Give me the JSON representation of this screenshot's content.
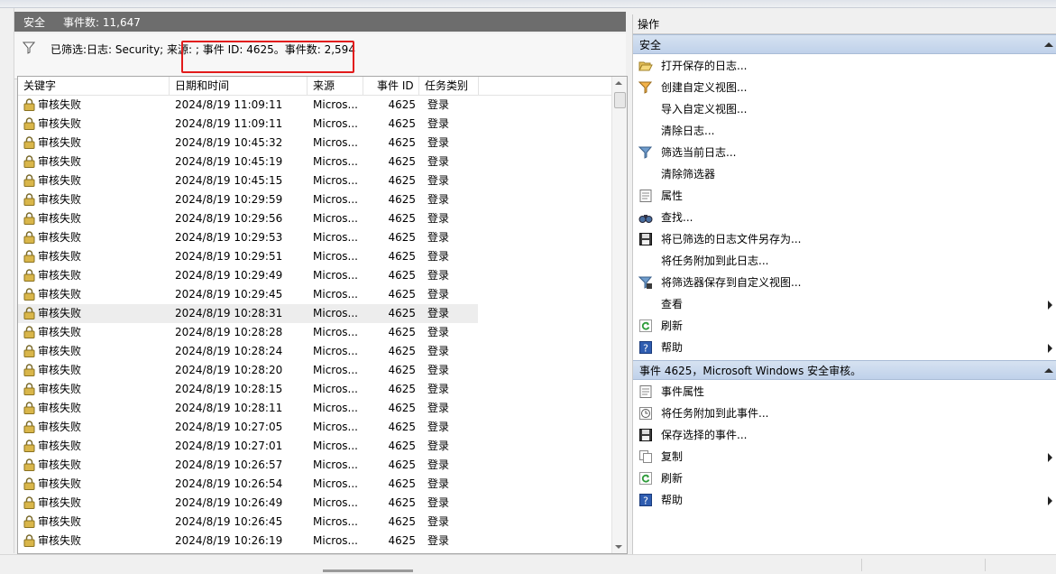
{
  "center": {
    "title": "安全",
    "count_label": "事件数: 11,647",
    "filter_text": "已筛选:日志: Security; 来源: ; 事件 ID: 4625。事件数: 2,594"
  },
  "grid": {
    "columns": [
      "关键字",
      "日期和时间",
      "来源",
      "事件 ID",
      "任务类别"
    ],
    "rows": [
      {
        "key": "审核失败",
        "date": "2024/8/19 11:09:11",
        "source": "Micros...",
        "id": "4625",
        "cat": "登录"
      },
      {
        "key": "审核失败",
        "date": "2024/8/19 11:09:11",
        "source": "Micros...",
        "id": "4625",
        "cat": "登录"
      },
      {
        "key": "审核失败",
        "date": "2024/8/19 10:45:32",
        "source": "Micros...",
        "id": "4625",
        "cat": "登录"
      },
      {
        "key": "审核失败",
        "date": "2024/8/19 10:45:19",
        "source": "Micros...",
        "id": "4625",
        "cat": "登录"
      },
      {
        "key": "审核失败",
        "date": "2024/8/19 10:45:15",
        "source": "Micros...",
        "id": "4625",
        "cat": "登录"
      },
      {
        "key": "审核失败",
        "date": "2024/8/19 10:29:59",
        "source": "Micros...",
        "id": "4625",
        "cat": "登录"
      },
      {
        "key": "审核失败",
        "date": "2024/8/19 10:29:56",
        "source": "Micros...",
        "id": "4625",
        "cat": "登录"
      },
      {
        "key": "审核失败",
        "date": "2024/8/19 10:29:53",
        "source": "Micros...",
        "id": "4625",
        "cat": "登录"
      },
      {
        "key": "审核失败",
        "date": "2024/8/19 10:29:51",
        "source": "Micros...",
        "id": "4625",
        "cat": "登录"
      },
      {
        "key": "审核失败",
        "date": "2024/8/19 10:29:49",
        "source": "Micros...",
        "id": "4625",
        "cat": "登录"
      },
      {
        "key": "审核失败",
        "date": "2024/8/19 10:29:45",
        "source": "Micros...",
        "id": "4625",
        "cat": "登录"
      },
      {
        "key": "审核失败",
        "date": "2024/8/19 10:28:31",
        "source": "Micros...",
        "id": "4625",
        "cat": "登录"
      },
      {
        "key": "审核失败",
        "date": "2024/8/19 10:28:28",
        "source": "Micros...",
        "id": "4625",
        "cat": "登录"
      },
      {
        "key": "审核失败",
        "date": "2024/8/19 10:28:24",
        "source": "Micros...",
        "id": "4625",
        "cat": "登录"
      },
      {
        "key": "审核失败",
        "date": "2024/8/19 10:28:20",
        "source": "Micros...",
        "id": "4625",
        "cat": "登录"
      },
      {
        "key": "审核失败",
        "date": "2024/8/19 10:28:15",
        "source": "Micros...",
        "id": "4625",
        "cat": "登录"
      },
      {
        "key": "审核失败",
        "date": "2024/8/19 10:28:11",
        "source": "Micros...",
        "id": "4625",
        "cat": "登录"
      },
      {
        "key": "审核失败",
        "date": "2024/8/19 10:27:05",
        "source": "Micros...",
        "id": "4625",
        "cat": "登录"
      },
      {
        "key": "审核失败",
        "date": "2024/8/19 10:27:01",
        "source": "Micros...",
        "id": "4625",
        "cat": "登录"
      },
      {
        "key": "审核失败",
        "date": "2024/8/19 10:26:57",
        "source": "Micros...",
        "id": "4625",
        "cat": "登录"
      },
      {
        "key": "审核失败",
        "date": "2024/8/19 10:26:54",
        "source": "Micros...",
        "id": "4625",
        "cat": "登录"
      },
      {
        "key": "审核失败",
        "date": "2024/8/19 10:26:49",
        "source": "Micros...",
        "id": "4625",
        "cat": "登录"
      },
      {
        "key": "审核失败",
        "date": "2024/8/19 10:26:45",
        "source": "Micros...",
        "id": "4625",
        "cat": "登录"
      },
      {
        "key": "审核失败",
        "date": "2024/8/19 10:26:19",
        "source": "Micros...",
        "id": "4625",
        "cat": "登录"
      }
    ]
  },
  "actions": {
    "title": "操作",
    "section1": {
      "title": "安全",
      "items": [
        {
          "label": "打开保存的日志...",
          "icon": "open-folder-icon"
        },
        {
          "label": "创建自定义视图...",
          "icon": "create-view-funnel-icon"
        },
        {
          "label": "导入自定义视图...",
          "icon": ""
        },
        {
          "label": "清除日志...",
          "icon": ""
        },
        {
          "label": "筛选当前日志...",
          "icon": "filter-funnel-icon"
        },
        {
          "label": "清除筛选器",
          "icon": ""
        },
        {
          "label": "属性",
          "icon": "properties-icon"
        },
        {
          "label": "查找...",
          "icon": "binoculars-icon"
        },
        {
          "label": "将已筛选的日志文件另存为...",
          "icon": "save-disk-icon"
        },
        {
          "label": "将任务附加到此日志...",
          "icon": ""
        },
        {
          "label": "将筛选器保存到自定义视图...",
          "icon": "save-filter-icon"
        },
        {
          "label": "查看",
          "icon": "",
          "submenu": true
        },
        {
          "label": "刷新",
          "icon": "refresh-icon"
        },
        {
          "label": "帮助",
          "icon": "help-icon",
          "submenu": true
        }
      ]
    },
    "section2": {
      "title": "事件 4625，Microsoft Windows 安全审核。",
      "items": [
        {
          "label": "事件属性",
          "icon": "event-properties-icon"
        },
        {
          "label": "将任务附加到此事件...",
          "icon": "attach-task-icon"
        },
        {
          "label": "保存选择的事件...",
          "icon": "save-disk-icon"
        },
        {
          "label": "复制",
          "icon": "copy-icon",
          "submenu": true
        },
        {
          "label": "刷新",
          "icon": "refresh-icon"
        },
        {
          "label": "帮助",
          "icon": "help-icon",
          "submenu": true
        }
      ]
    }
  },
  "colors": {
    "highlight_box": "#e21b1b",
    "section_header": "#c9d8ee",
    "title_bar": "#6d6d6d"
  }
}
